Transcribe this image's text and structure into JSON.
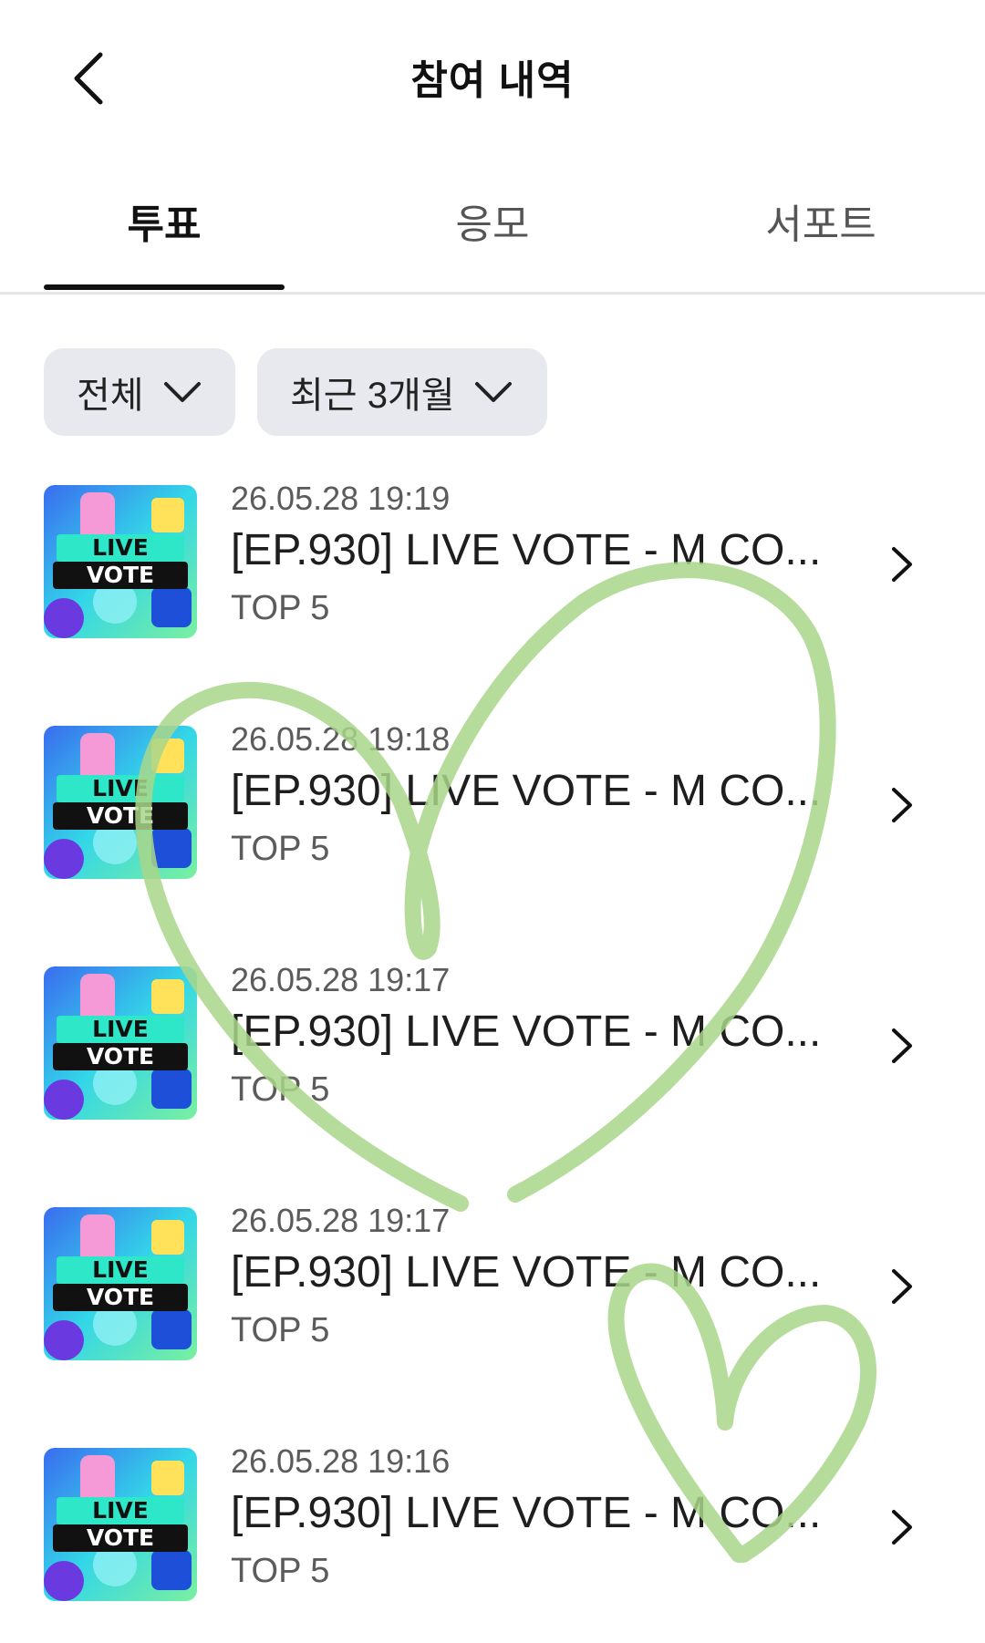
{
  "header": {
    "title": "참여 내역"
  },
  "tabs": [
    {
      "label": "투표",
      "active": true
    },
    {
      "label": "응모",
      "active": false
    },
    {
      "label": "서포트",
      "active": false
    }
  ],
  "filters": {
    "type": "전체",
    "period": "최근 3개월"
  },
  "thumbnail": {
    "line1": "LIVE",
    "line2": "VOTE"
  },
  "items": [
    {
      "date": "26.05.28 19:19",
      "title": "[EP.930] LIVE VOTE - M CO...",
      "sub": "TOP 5"
    },
    {
      "date": "26.05.28 19:18",
      "title": "[EP.930] LIVE VOTE - M CO...",
      "sub": "TOP 5"
    },
    {
      "date": "26.05.28 19:17",
      "title": "[EP.930] LIVE VOTE - M CO...",
      "sub": "TOP 5"
    },
    {
      "date": "26.05.28 19:17",
      "title": "[EP.930] LIVE VOTE - M CO...",
      "sub": "TOP 5"
    },
    {
      "date": "26.05.28 19:16",
      "title": "[EP.930] LIVE VOTE - M CO...",
      "sub": "TOP 5"
    }
  ],
  "colors": {
    "tab_active": "#111111",
    "filter_bg": "#e8e9ee",
    "heart_doodle": "#a9d68a"
  }
}
